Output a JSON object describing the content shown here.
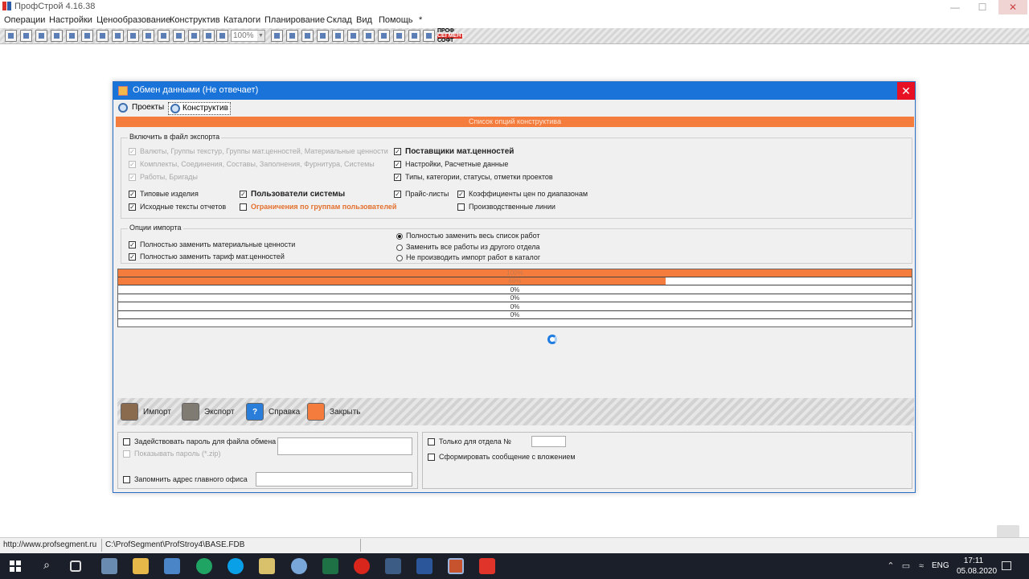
{
  "app": {
    "title": "ПрофСтрой 4.16.38",
    "minimize": "—",
    "maximize": "☐",
    "close": "✕"
  },
  "menu": [
    "Операции",
    "Настройки",
    "Ценообразование",
    "Конструктив",
    "Каталоги",
    "Планирование",
    "Склад",
    "Вид",
    "Помощь",
    "*"
  ],
  "toolbar": {
    "zoom_value": "100%",
    "logo_top": "ПРОФ",
    "logo_mid": "СЕГМЕНТ",
    "logo_bottom": "СОФТ"
  },
  "dialog": {
    "title": "Обмен данными (Не отвечает)",
    "close_glyph": "✕",
    "tabs": [
      "Проекты",
      "Конструктив"
    ],
    "active_tab": "Конструктив",
    "options_band": "Список опций конструктива",
    "export_group": {
      "title": "Включить в файл экспорта",
      "items": [
        {
          "label": "Валюты, Группы текстур, Группы мат.ценностей, Материальные ценности",
          "checked": true,
          "disabled": true
        },
        {
          "label": "Комплекты, Соединения, Составы, Заполнения, Фурнитура, Системы",
          "checked": true,
          "disabled": true
        },
        {
          "label": "Работы, Бригады",
          "checked": true,
          "disabled": true
        },
        {
          "label": "Поставщики мат.ценностей",
          "checked": true,
          "bold": true
        },
        {
          "label": "Настройки, Расчетные данные",
          "checked": true
        },
        {
          "label": "Типы, категории, статусы, отметки проектов",
          "checked": true
        },
        {
          "label": "Типовые изделия",
          "checked": true
        },
        {
          "label": "Исходные тексты отчетов",
          "checked": true
        },
        {
          "label": "Пользователи системы",
          "checked": true,
          "bold": true
        },
        {
          "label": "Ограничения по группам пользователей",
          "checked": false,
          "orange": true
        },
        {
          "label": "Прайс-листы",
          "checked": true
        },
        {
          "label": "Коэффициенты цен по диапазонам",
          "checked": true
        },
        {
          "label": "Производственные линии",
          "checked": false
        }
      ]
    },
    "import_group": {
      "title": "Опции импорта",
      "checkboxes": [
        {
          "label": "Полностью заменить материальные ценности",
          "checked": true
        },
        {
          "label": "Полностью заменить тариф мат.ценностей",
          "checked": true
        }
      ],
      "radios": [
        {
          "label": "Полностью заменить весь список работ",
          "selected": true
        },
        {
          "label": "Заменить все работы из другого отдела",
          "selected": false
        },
        {
          "label": "Не производить импорт работ в каталог",
          "selected": false
        }
      ]
    },
    "progress": [
      {
        "label": "100%",
        "value": 100
      },
      {
        "label": "69%",
        "value": 69
      },
      {
        "label": "0%",
        "value": 0
      },
      {
        "label": "0%",
        "value": 0
      },
      {
        "label": "0%",
        "value": 0
      },
      {
        "label": "0%",
        "value": 0
      }
    ],
    "actions": [
      "Импорт",
      "Экспорт",
      "Справка",
      "Закрыть"
    ],
    "bottom": {
      "use_password": "Задействовать пароль для файла обмена",
      "show_password": "Показывать пароль (*.zip)",
      "remember_address": "Запомнить адрес главного офиса",
      "only_dept": "Только для отдела №",
      "make_message": "Сформировать сообщение с вложением"
    }
  },
  "status": {
    "url": "http://www.profsegment.ru",
    "db_path": "C:\\ProfSegment\\ProfStroy4\\BASE.FDB"
  },
  "taskbar": {
    "lang": "ENG",
    "time": "17:11",
    "date": "05.08.2020"
  },
  "colors": {
    "accent_orange": "#f47c3c",
    "title_blue": "#1a73d8",
    "close_red": "#e81123"
  }
}
